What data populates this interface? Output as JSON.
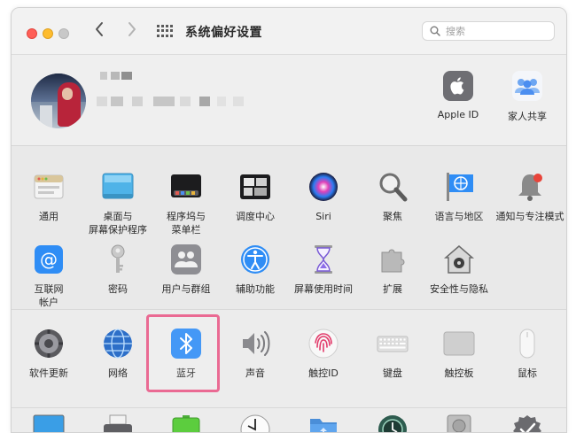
{
  "window": {
    "title": "系统偏好设置",
    "search_placeholder": "搜索"
  },
  "account": {
    "items": [
      {
        "label": "Apple ID",
        "icon": "apple-icon"
      },
      {
        "label": "家人共享",
        "icon": "family-sharing-icon"
      }
    ]
  },
  "section1": {
    "row1": [
      {
        "label": "通用",
        "icon": "general-icon"
      },
      {
        "label": "桌面与\n屏幕保护程序",
        "icon": "desktop-screensaver-icon"
      },
      {
        "label": "程序坞与\n菜单栏",
        "icon": "dock-menubar-icon"
      },
      {
        "label": "调度中心",
        "icon": "mission-control-icon"
      },
      {
        "label": "Siri",
        "icon": "siri-icon"
      },
      {
        "label": "聚焦",
        "icon": "spotlight-icon"
      },
      {
        "label": "语言与地区",
        "icon": "language-region-icon"
      },
      {
        "label": "通知与专注模式",
        "icon": "notifications-focus-icon"
      }
    ],
    "row2": [
      {
        "label": "互联网\n帐户",
        "icon": "internet-accounts-icon"
      },
      {
        "label": "密码",
        "icon": "passwords-icon"
      },
      {
        "label": "用户与群组",
        "icon": "users-groups-icon"
      },
      {
        "label": "辅助功能",
        "icon": "accessibility-icon"
      },
      {
        "label": "屏幕使用时间",
        "icon": "screen-time-icon"
      },
      {
        "label": "扩展",
        "icon": "extensions-icon"
      },
      {
        "label": "安全性与隐私",
        "icon": "security-privacy-icon"
      }
    ]
  },
  "section2": {
    "row1": [
      {
        "label": "软件更新",
        "icon": "software-update-icon"
      },
      {
        "label": "网络",
        "icon": "network-icon"
      },
      {
        "label": "蓝牙",
        "icon": "bluetooth-icon"
      },
      {
        "label": "声音",
        "icon": "sound-icon"
      },
      {
        "label": "触控ID",
        "icon": "touch-id-icon"
      },
      {
        "label": "键盘",
        "icon": "keyboard-icon"
      },
      {
        "label": "触控板",
        "icon": "trackpad-icon"
      },
      {
        "label": "鼠标",
        "icon": "mouse-icon"
      }
    ]
  },
  "section3": {
    "row1": [
      {
        "icon": "displays-icon"
      },
      {
        "icon": "printers-scanners-icon"
      },
      {
        "icon": "battery-icon"
      },
      {
        "icon": "date-time-icon"
      },
      {
        "icon": "sharing-icon"
      },
      {
        "icon": "time-machine-icon"
      },
      {
        "icon": "startup-disk-icon"
      },
      {
        "icon": "profiles-icon"
      }
    ]
  },
  "colors": {
    "highlight": "#ea6a93",
    "bluetooth": "#2f8df5",
    "window_bg": "#ececec"
  }
}
